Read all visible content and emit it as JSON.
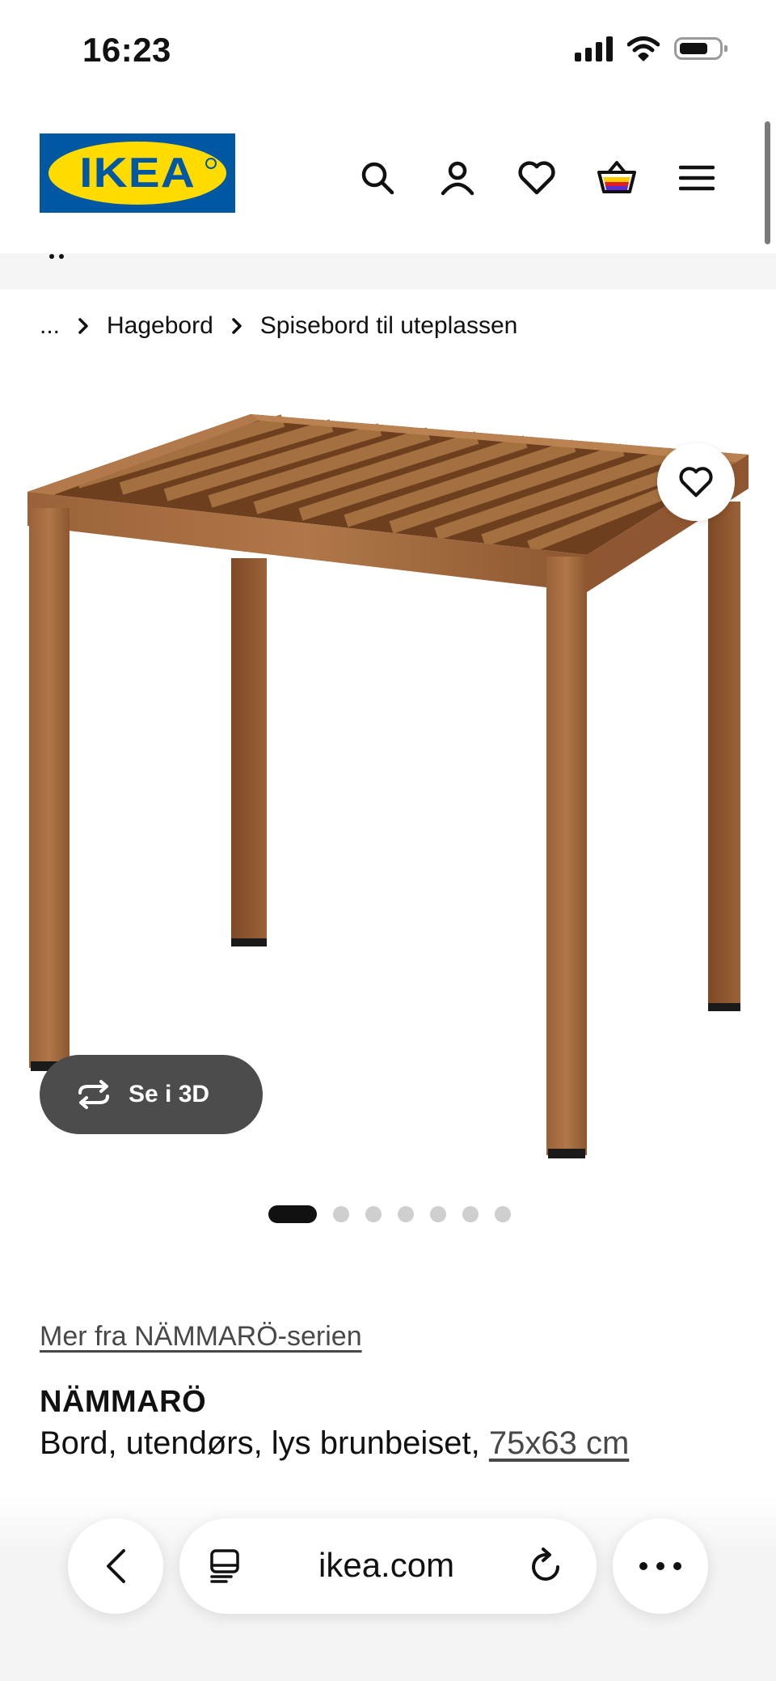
{
  "status_bar": {
    "time": "16:23",
    "icons": [
      "signal-icon",
      "wifi-icon",
      "battery-icon"
    ]
  },
  "header": {
    "logo_text": "IKEA",
    "icons": [
      "search-icon",
      "account-icon",
      "heart-icon",
      "cart-icon",
      "menu-icon"
    ],
    "colors": {
      "logo_blue": "#0058a3",
      "logo_yellow": "#ffdb00"
    }
  },
  "breadcrumb": {
    "items": [
      "...",
      "Hagebord",
      "Spisebord til uteplassen"
    ],
    "separator_icon": "chevron-right-icon"
  },
  "product_image": {
    "wishlist_icon": "heart-icon",
    "view_3d_label": "Se i 3D",
    "view_3d_icon": "rotate-3d-icon",
    "carousel": {
      "total": 7,
      "active_index": 0
    }
  },
  "product": {
    "series_link": "Mer fra NÄMMARÖ-serien",
    "name": "NÄMMARÖ",
    "description": "Bord, utendørs, lys brunbeiset,",
    "size": "75x63 cm"
  },
  "browser": {
    "url": "ikea.com",
    "icons": [
      "back-icon",
      "tabs-icon",
      "reload-icon",
      "more-icon"
    ]
  }
}
